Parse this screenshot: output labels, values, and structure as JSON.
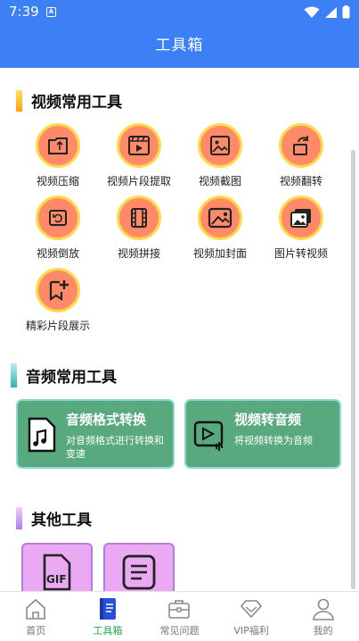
{
  "status": {
    "time": "7:39",
    "notif_letter": "A"
  },
  "appbar": {
    "title": "工具箱"
  },
  "video_section": {
    "title": "视频常用工具",
    "accent": "#ffb000",
    "tools": [
      {
        "label": "视频压缩",
        "icon": "compress-icon"
      },
      {
        "label": "视频片段提取",
        "icon": "clip-extract-icon"
      },
      {
        "label": "视频截图",
        "icon": "screenshot-icon"
      },
      {
        "label": "视频翻转",
        "icon": "flip-icon"
      },
      {
        "label": "视频倒放",
        "icon": "reverse-icon"
      },
      {
        "label": "视频拼接",
        "icon": "film-join-icon"
      },
      {
        "label": "视频加封面",
        "icon": "cover-icon"
      },
      {
        "label": "图片转视频",
        "icon": "image-to-video-icon"
      },
      {
        "label": "精彩片段展示",
        "icon": "highlight-icon"
      }
    ]
  },
  "audio_section": {
    "title": "音频常用工具",
    "accent": "#4fc7c7",
    "cards": [
      {
        "title": "音频格式转换",
        "desc": "对音频格式进行转换和变速",
        "icon": "music-file-icon"
      },
      {
        "title": "视频转音频",
        "desc": "将视频转换为音频",
        "icon": "video-audio-icon"
      }
    ]
  },
  "other_section": {
    "title": "其他工具",
    "accent": "#c98cf0",
    "cards": [
      {
        "icon": "gif-icon"
      },
      {
        "icon": "document-icon"
      }
    ]
  },
  "bottom_nav": {
    "active_color": "#1fa84a",
    "items": [
      {
        "label": "首页",
        "icon": "home-icon"
      },
      {
        "label": "工具箱",
        "icon": "toolbox-book-icon",
        "active": true
      },
      {
        "label": "常见问题",
        "icon": "briefcase-icon"
      },
      {
        "label": "VIP福利",
        "icon": "diamond-icon"
      },
      {
        "label": "我的",
        "icon": "person-icon"
      }
    ]
  }
}
